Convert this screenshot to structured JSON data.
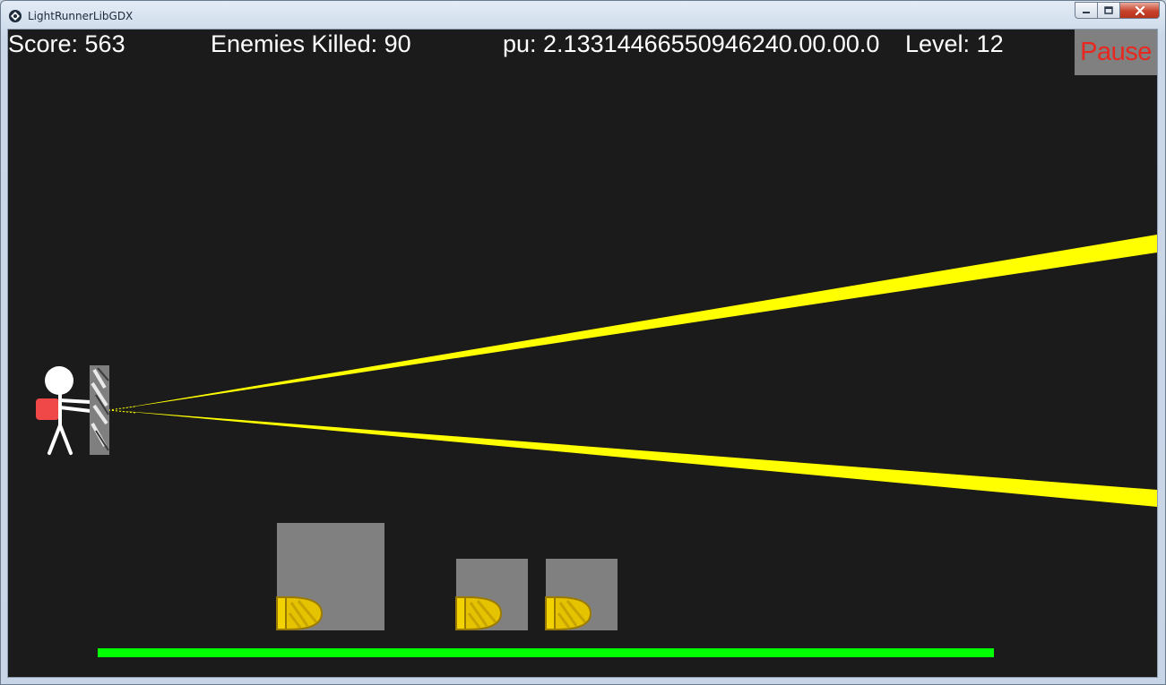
{
  "window": {
    "title": "LightRunnerLibGDX",
    "controls": {
      "minimize": "minimize-icon",
      "maximize": "maximize-icon",
      "close": "close-icon"
    }
  },
  "hud": {
    "score_text": "Score: 563",
    "enemies_text": "Enemies Killed: 90",
    "powerup_text": "pu: 2.13314466550946240.00.00.0",
    "level_text": "Level: 12",
    "pause_label": "Pause"
  },
  "game": {
    "background_color": "#1b1b1b",
    "light_beam_color": "#ffff00",
    "health_bar_color": "#00ff00",
    "pause_text_color": "#e8281e",
    "crate_color": "#808080",
    "player_backpack_color": "#f04848",
    "crates": [
      {
        "name": "large-crate",
        "coin": "coin-icon"
      },
      {
        "name": "small-crate",
        "coin": "coin-icon"
      },
      {
        "name": "small-crate",
        "coin": "coin-icon"
      }
    ]
  }
}
